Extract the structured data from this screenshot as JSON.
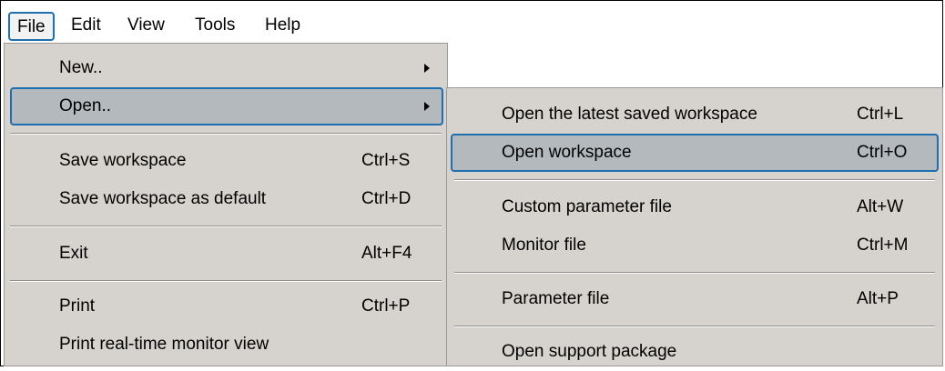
{
  "menubar": {
    "items": [
      {
        "label": "File"
      },
      {
        "label": "Edit"
      },
      {
        "label": "View"
      },
      {
        "label": "Tools"
      },
      {
        "label": "Help"
      }
    ]
  },
  "file_menu": {
    "new": {
      "label": "New.."
    },
    "open": {
      "label": "Open.."
    },
    "save_workspace": {
      "label": "Save workspace",
      "shortcut": "Ctrl+S"
    },
    "save_default": {
      "label": "Save workspace as default",
      "shortcut": "Ctrl+D"
    },
    "exit": {
      "label": "Exit",
      "shortcut": "Alt+F4"
    },
    "print": {
      "label": "Print",
      "shortcut": "Ctrl+P"
    },
    "print_monitor": {
      "label": "Print real-time monitor view"
    }
  },
  "open_submenu": {
    "latest": {
      "label": "Open the latest saved workspace",
      "shortcut": "Ctrl+L"
    },
    "workspace": {
      "label": "Open workspace",
      "shortcut": "Ctrl+O"
    },
    "custom_param": {
      "label": "Custom parameter file",
      "shortcut": "Alt+W"
    },
    "monitor": {
      "label": "Monitor file",
      "shortcut": "Ctrl+M"
    },
    "param": {
      "label": "Parameter file",
      "shortcut": "Alt+P"
    },
    "support": {
      "label": "Open support package"
    }
  },
  "colors": {
    "menu_bg": "#d6d3ce",
    "highlight_bg": "#b4b9bd",
    "focus_border": "#1e6fb0"
  }
}
